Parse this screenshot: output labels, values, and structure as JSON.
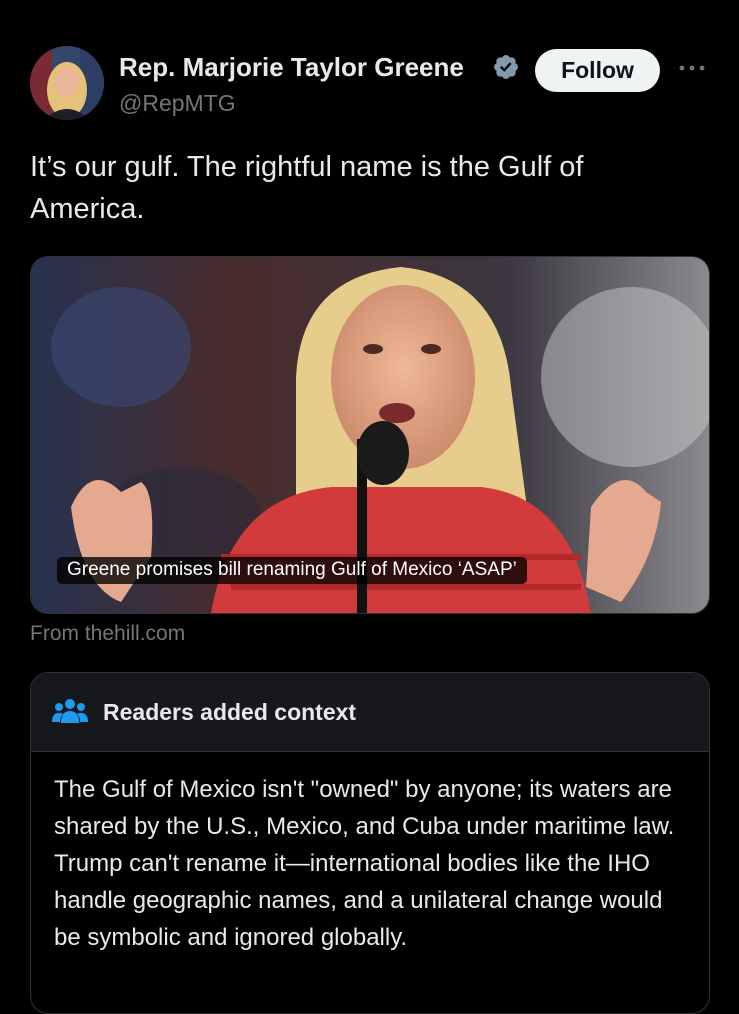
{
  "post": {
    "author_name": "Rep. Marjorie Taylor Greene",
    "handle": "@RepMTG",
    "follow_label": "Follow",
    "text": "It’s our gulf. The rightful name is the Gulf of America."
  },
  "link_card": {
    "headline": "Greene promises bill renaming Gulf of Mexico ‘ASAP’",
    "source": "From thehill.com"
  },
  "community_note": {
    "title": "Readers added context",
    "body": "The Gulf of Mexico isn't \"owned\" by anyone; its waters are shared by the U.S., Mexico, and Cuba under maritime law. Trump can't rename it—international bodies like the IHO handle geographic names, and a unilateral change would be symbolic and ignored globally."
  },
  "icons": {
    "verified": "verified-badge-icon",
    "more": "more-options-icon",
    "readers": "people-group-icon"
  },
  "colors": {
    "background": "#000000",
    "text": "#e7e9ea",
    "muted": "#71767b",
    "follow_bg": "#eff3f4",
    "verified_badge": "#829aab",
    "readers_icon": "#1d9bf0"
  }
}
